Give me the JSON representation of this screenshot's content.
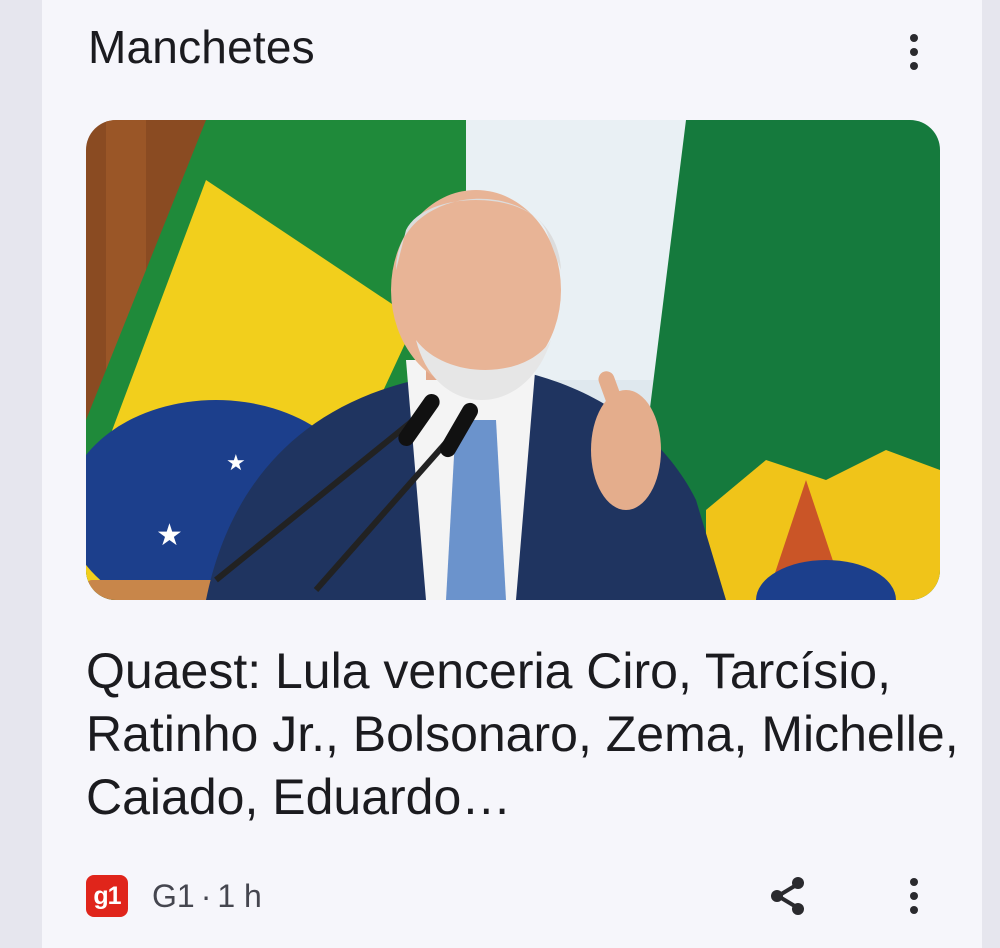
{
  "section": {
    "title": "Manchetes"
  },
  "article": {
    "image_icon": "news-photo",
    "headline": "Quaest: Lula venceria Ciro, Tarcísio, Ratinho Jr., Bolsonaro, Zema, Michelle, Caiado, Eduardo…",
    "publisher_logo_text": "g1",
    "publisher": "G1",
    "separator": "·",
    "age": "1 h"
  },
  "icons": {
    "more": "more-vert-icon",
    "share": "share-icon"
  },
  "colors": {
    "publisher_logo_bg": "#e0251b",
    "text_primary": "#1b1b1f",
    "text_secondary": "#45464f",
    "card_bg": "#f6f6fb"
  }
}
